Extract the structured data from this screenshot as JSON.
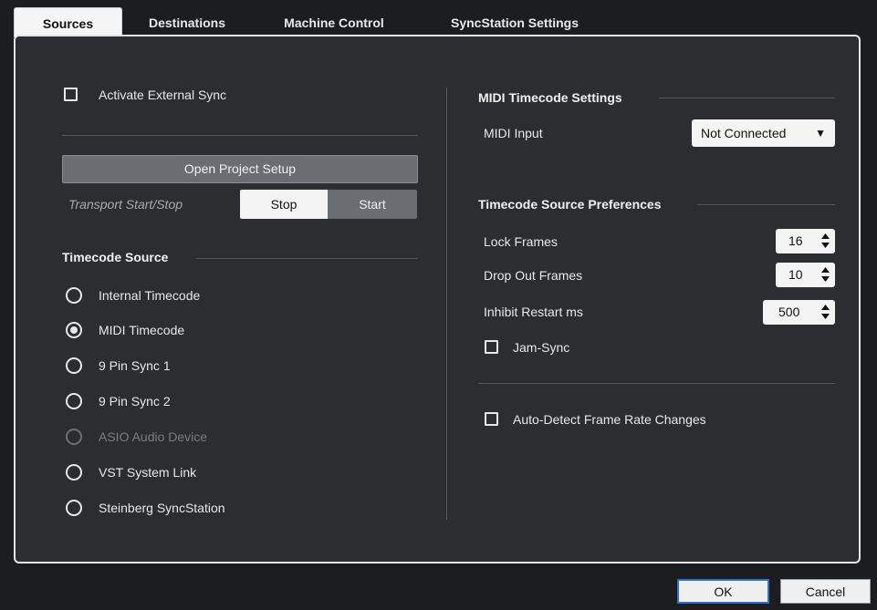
{
  "tabs": [
    {
      "label": "Sources",
      "active": true
    },
    {
      "label": "Destinations"
    },
    {
      "label": "Machine Control"
    },
    {
      "label": "SyncStation Settings"
    }
  ],
  "left": {
    "activate_external_sync": {
      "label": "Activate External Sync",
      "checked": false
    },
    "open_project_setup": "Open Project Setup",
    "transport": {
      "label": "Transport Start/Stop",
      "stop": "Stop",
      "start": "Start",
      "selected": "Stop"
    },
    "timecode_source": {
      "title": "Timecode Source",
      "options": [
        {
          "label": "Internal Timecode",
          "selected": false,
          "disabled": false
        },
        {
          "label": "MIDI Timecode",
          "selected": true,
          "disabled": false
        },
        {
          "label": "9 Pin Sync 1",
          "selected": false,
          "disabled": false
        },
        {
          "label": "9 Pin Sync 2",
          "selected": false,
          "disabled": false
        },
        {
          "label": "ASIO Audio Device",
          "selected": false,
          "disabled": true
        },
        {
          "label": "VST System Link",
          "selected": false,
          "disabled": false
        },
        {
          "label": "Steinberg SyncStation",
          "selected": false,
          "disabled": false
        }
      ]
    }
  },
  "right": {
    "midi_timecode": {
      "title": "MIDI Timecode Settings",
      "midi_input_label": "MIDI Input",
      "midi_input_value": "Not Connected"
    },
    "prefs": {
      "title": "Timecode Source Preferences",
      "lock_frames": {
        "label": "Lock Frames",
        "value": "16"
      },
      "drop_out_frames": {
        "label": "Drop Out Frames",
        "value": "10"
      },
      "inhibit_restart": {
        "label": "Inhibit Restart ms",
        "value": "500"
      },
      "jam_sync": {
        "label": "Jam-Sync",
        "checked": false
      }
    },
    "auto_detect": {
      "label": "Auto-Detect Frame Rate Changes",
      "checked": false
    }
  },
  "footer": {
    "ok": "OK",
    "cancel": "Cancel"
  }
}
